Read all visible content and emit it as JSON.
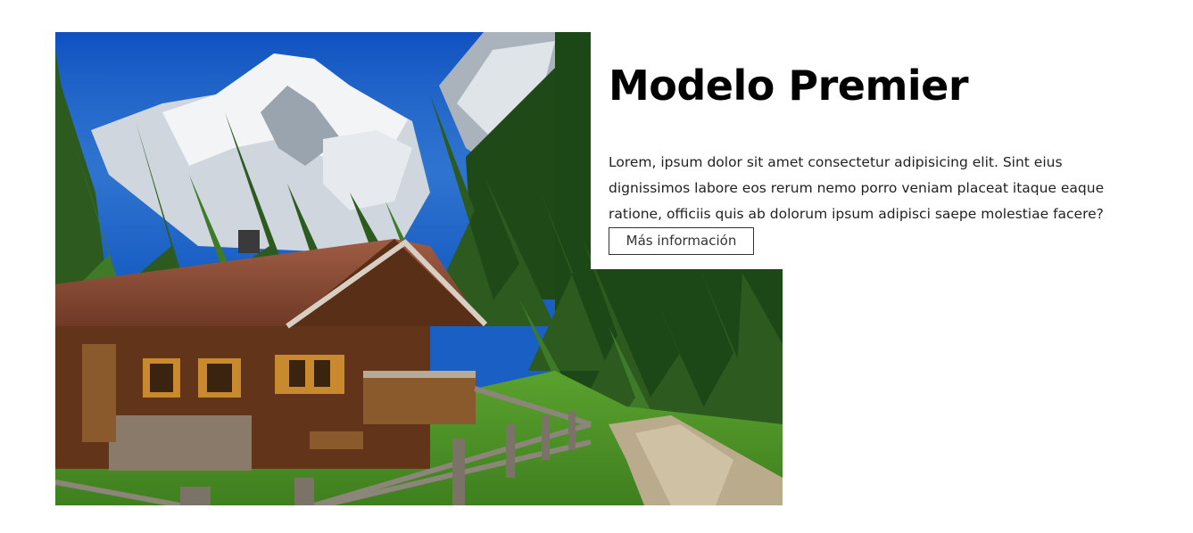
{
  "card": {
    "title": "Modelo Premier",
    "description": "Lorem, ipsum dolor sit amet consectetur adipisicing elit. Sint eius dignissimos labore eos rerum nemo porro veniam placeat itaque eaque ratione, officiis quis ab dolorum ipsum adipisci saepe molestiae facere?",
    "button_label": "Más información"
  },
  "colors": {
    "sky": "#1a5fc4",
    "snow": "#e8ecf0",
    "forest": "#2d5a1f",
    "grass": "#4f9a2a",
    "roof": "#8a4a32",
    "wood": "#6b3a1e"
  }
}
